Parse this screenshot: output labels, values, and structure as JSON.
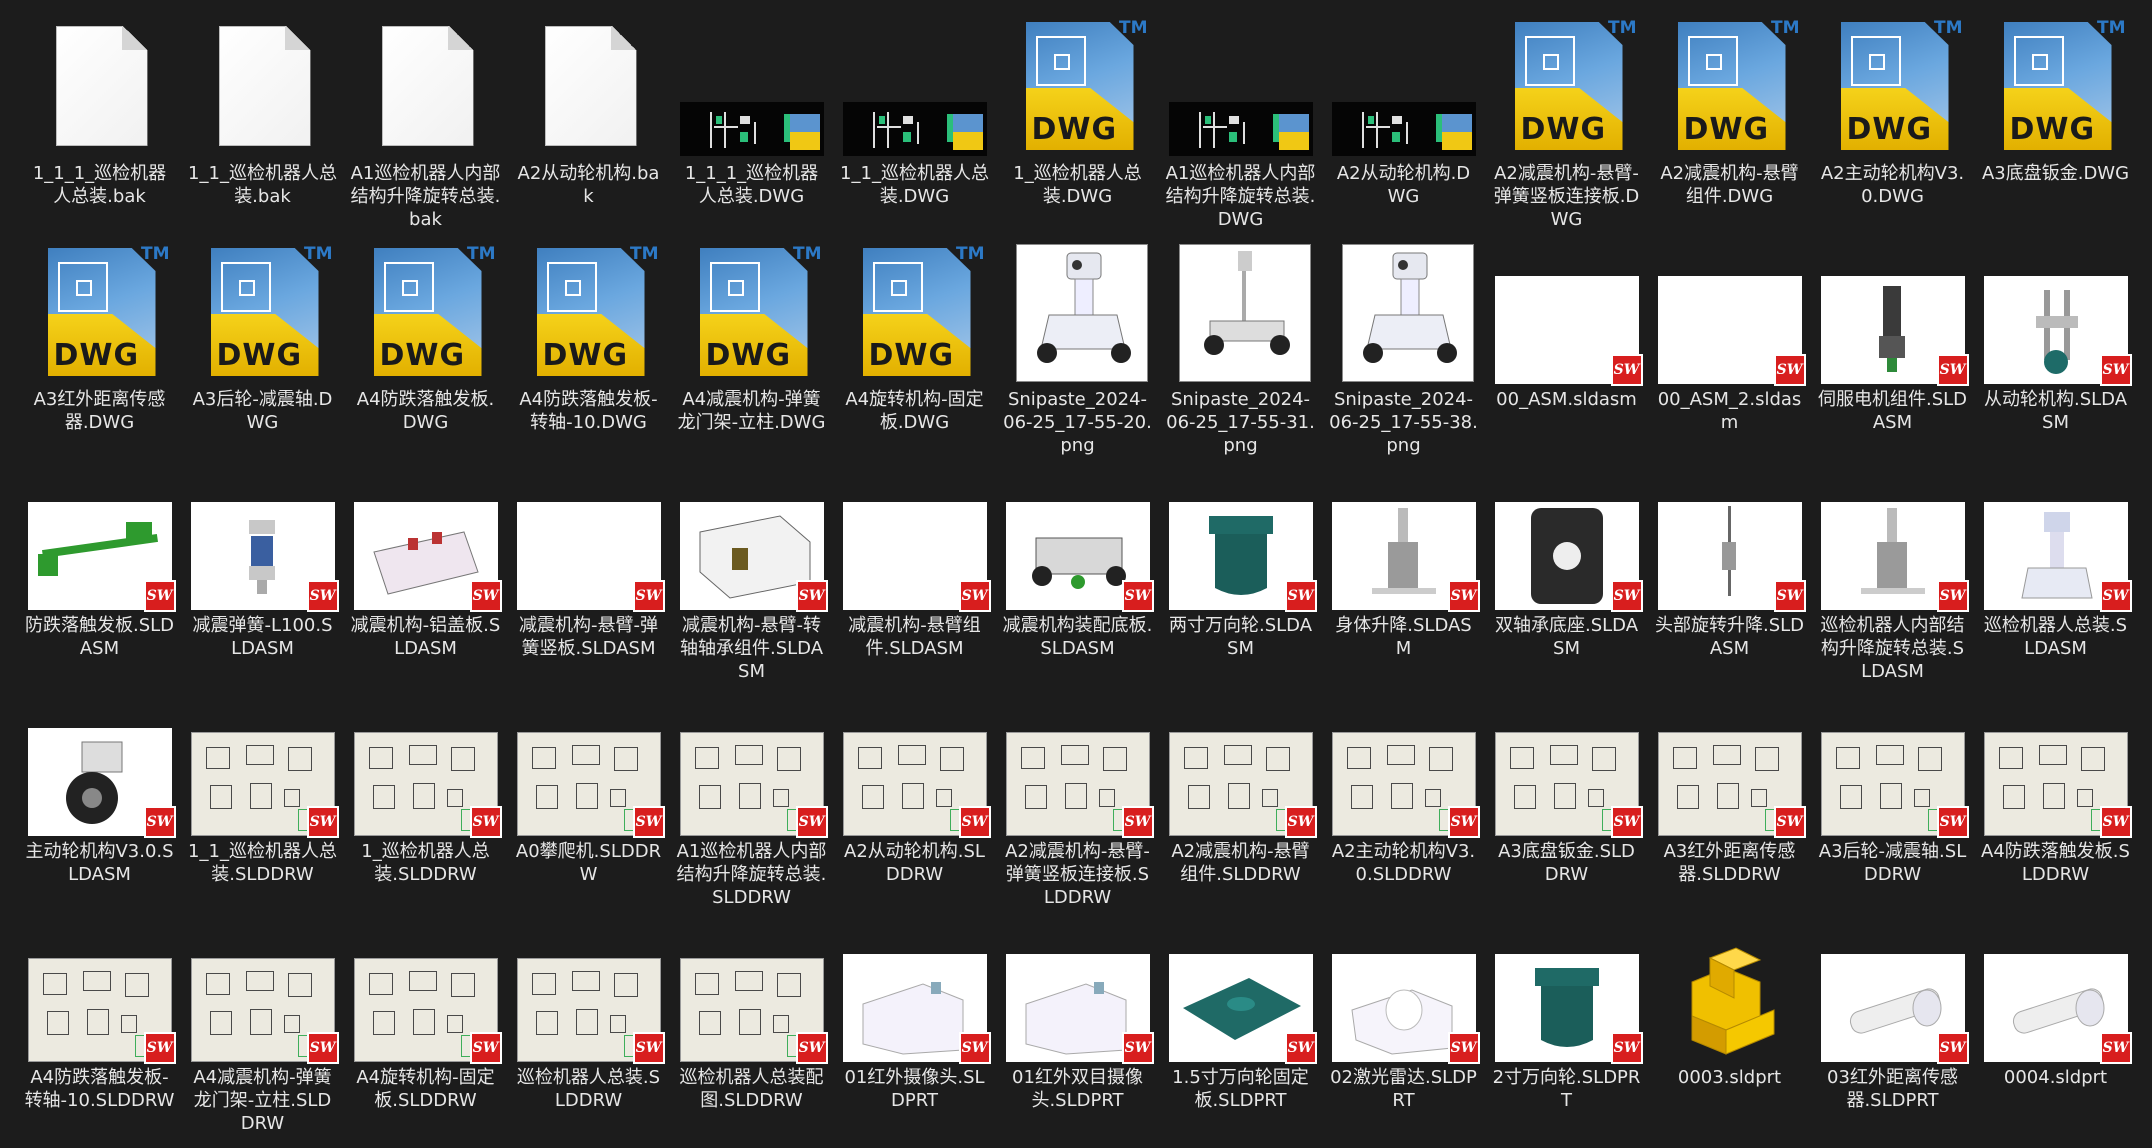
{
  "files": [
    {
      "name": "1_1_1_巡检机器人总装.bak",
      "icon": "blank-doc-icon"
    },
    {
      "name": "1_1_巡检机器人总装.bak",
      "icon": "blank-doc-icon"
    },
    {
      "name": "A1巡检机器人内部结构升降旋转总装.bak",
      "icon": "blank-doc-icon"
    },
    {
      "name": "A2从动轮机构.bak",
      "icon": "blank-doc-icon"
    },
    {
      "name": "1_1_1_巡检机器人总装.DWG",
      "icon": "dwg-drawing-thumb"
    },
    {
      "name": "1_1_巡检机器人总装.DWG",
      "icon": "dwg-drawing-thumb"
    },
    {
      "name": "1_巡检机器人总装.DWG",
      "icon": "dwg-icon"
    },
    {
      "name": "A1巡检机器人内部结构升降旋转总装.DWG",
      "icon": "dwg-drawing-thumb"
    },
    {
      "name": "A2从动轮机构.DWG",
      "icon": "dwg-drawing-thumb"
    },
    {
      "name": "A2减震机构-悬臂-弹簧竖板连接板.DWG",
      "icon": "dwg-icon"
    },
    {
      "name": "A2减震机构-悬臂组件.DWG",
      "icon": "dwg-icon"
    },
    {
      "name": "A2主动轮机构V3.0.DWG",
      "icon": "dwg-icon"
    },
    {
      "name": "A3底盘钣金.DWG",
      "icon": "dwg-icon"
    },
    {
      "name": "A3红外距离传感器.DWG",
      "icon": "dwg-icon"
    },
    {
      "name": "A3后轮-减震轴.DWG",
      "icon": "dwg-icon"
    },
    {
      "name": "A4防跌落触发板.DWG",
      "icon": "dwg-icon"
    },
    {
      "name": "A4防跌落触发板-转轴-10.DWG",
      "icon": "dwg-icon"
    },
    {
      "name": "A4减震机构-弹簧龙门架-立柱.DWG",
      "icon": "dwg-icon"
    },
    {
      "name": "A4旋转机构-固定板.DWG",
      "icon": "dwg-icon"
    },
    {
      "name": "Snipaste_2024-06-25_17-55-20.png",
      "icon": "png-robot-thumb"
    },
    {
      "name": "Snipaste_2024-06-25_17-55-31.png",
      "icon": "png-robot-frame-thumb"
    },
    {
      "name": "Snipaste_2024-06-25_17-55-38.png",
      "icon": "png-robot-thumb"
    },
    {
      "name": "00_ASM.sldasm",
      "icon": "sw-blank-thumb"
    },
    {
      "name": "00_ASM_2.sldasm",
      "icon": "sw-blank-thumb"
    },
    {
      "name": "伺服电机组件.SLDASM",
      "icon": "sw-motor-thumb"
    },
    {
      "name": "从动轮机构.SLDASM",
      "icon": "sw-mechanism-thumb"
    },
    {
      "name": "防跌落触发板.SLDASM",
      "icon": "sw-green-part-thumb"
    },
    {
      "name": "减震弹簧-L100.SLDASM",
      "icon": "sw-spring-thumb"
    },
    {
      "name": "减震机构-铝盖板.SLDASM",
      "icon": "sw-plate-thumb"
    },
    {
      "name": "减震机构-悬臂-弹簧竖板.SLDASM",
      "icon": "sw-blank-thumb"
    },
    {
      "name": "减震机构-悬臂-转轴轴承组件.SLDASM",
      "icon": "sw-block-thumb"
    },
    {
      "name": "减震机构-悬臂组件.SLDASM",
      "icon": "sw-blank-thumb"
    },
    {
      "name": "减震机构装配底板.SLDASM",
      "icon": "sw-chassis-thumb"
    },
    {
      "name": "两寸万向轮.SLDASM",
      "icon": "sw-caster-thumb"
    },
    {
      "name": "身体升降.SLDASM",
      "icon": "sw-lift-thumb"
    },
    {
      "name": "双轴承底座.SLDASM",
      "icon": "sw-bearing-thumb"
    },
    {
      "name": "头部旋转升降.SLDASM",
      "icon": "sw-rod-thumb"
    },
    {
      "name": "巡检机器人内部结构升降旋转总装.SLDASM",
      "icon": "sw-lift-thumb"
    },
    {
      "name": "巡检机器人总装.SLDASM",
      "icon": "sw-robot-thumb"
    },
    {
      "name": "主动轮机构V3.0.SLDASM",
      "icon": "sw-wheel-thumb"
    },
    {
      "name": "1_1_巡检机器人总装.SLDDRW",
      "icon": "sw-drawing-thumb"
    },
    {
      "name": "1_巡检机器人总装.SLDDRW",
      "icon": "sw-drawing-thumb"
    },
    {
      "name": "A0攀爬机.SLDDRW",
      "icon": "sw-drawing-thumb"
    },
    {
      "name": "A1巡检机器人内部结构升降旋转总装.SLDDRW",
      "icon": "sw-drawing-thumb"
    },
    {
      "name": "A2从动轮机构.SLDDRW",
      "icon": "sw-drawing-thumb"
    },
    {
      "name": "A2减震机构-悬臂-弹簧竖板连接板.SLDDRW",
      "icon": "sw-drawing-thumb"
    },
    {
      "name": "A2减震机构-悬臂组件.SLDDRW",
      "icon": "sw-drawing-thumb"
    },
    {
      "name": "A2主动轮机构V3.0.SLDDRW",
      "icon": "sw-drawing-thumb"
    },
    {
      "name": "A3底盘钣金.SLDDRW",
      "icon": "sw-drawing-thumb"
    },
    {
      "name": "A3红外距离传感器.SLDDRW",
      "icon": "sw-drawing-thumb"
    },
    {
      "name": "A3后轮-减震轴.SLDDRW",
      "icon": "sw-drawing-thumb"
    },
    {
      "name": "A4防跌落触发板.SLDDRW",
      "icon": "sw-drawing-thumb"
    },
    {
      "name": "A4防跌落触发板-转轴-10.SLDDRW",
      "icon": "sw-drawing-thumb"
    },
    {
      "name": "A4减震机构-弹簧龙门架-立柱.SLDDRW",
      "icon": "sw-drawing-thumb"
    },
    {
      "name": "A4旋转机构-固定板.SLDDRW",
      "icon": "sw-drawing-thumb"
    },
    {
      "name": "巡检机器人总装.SLDDRW",
      "icon": "sw-drawing-thumb"
    },
    {
      "name": "巡检机器人总装配图.SLDDRW",
      "icon": "sw-drawing-thumb"
    },
    {
      "name": "01红外摄像头.SLDPRT",
      "icon": "sw-camera-thumb"
    },
    {
      "name": "01红外双目摄像头.SLDPRT",
      "icon": "sw-camera-thumb"
    },
    {
      "name": "1.5寸万向轮固定板.SLDPRT",
      "icon": "sw-teal-plate-thumb"
    },
    {
      "name": "02激光雷达.SLDPRT",
      "icon": "sw-lidar-thumb"
    },
    {
      "name": "2寸万向轮.SLDPRT",
      "icon": "sw-caster-thumb"
    },
    {
      "name": "0003.sldprt",
      "icon": "part-3d-icon"
    },
    {
      "name": "03红外距离传感器.SLDPRT",
      "icon": "sw-sensor-thumb"
    },
    {
      "name": "0004.sldprt",
      "icon": "sw-sensor-thumb"
    }
  ],
  "labels": {
    "dwg": "DWG",
    "tm": "TM",
    "sw": "SW"
  },
  "colors": {
    "background": "#1c1c1c",
    "text": "#e6e6e6",
    "sw_red": "#d81e1e",
    "dwg_yellow": "#f5d21a",
    "dwg_blue": "#3f7fbf",
    "teal": "#1f6a66",
    "green": "#2e9a2e"
  }
}
